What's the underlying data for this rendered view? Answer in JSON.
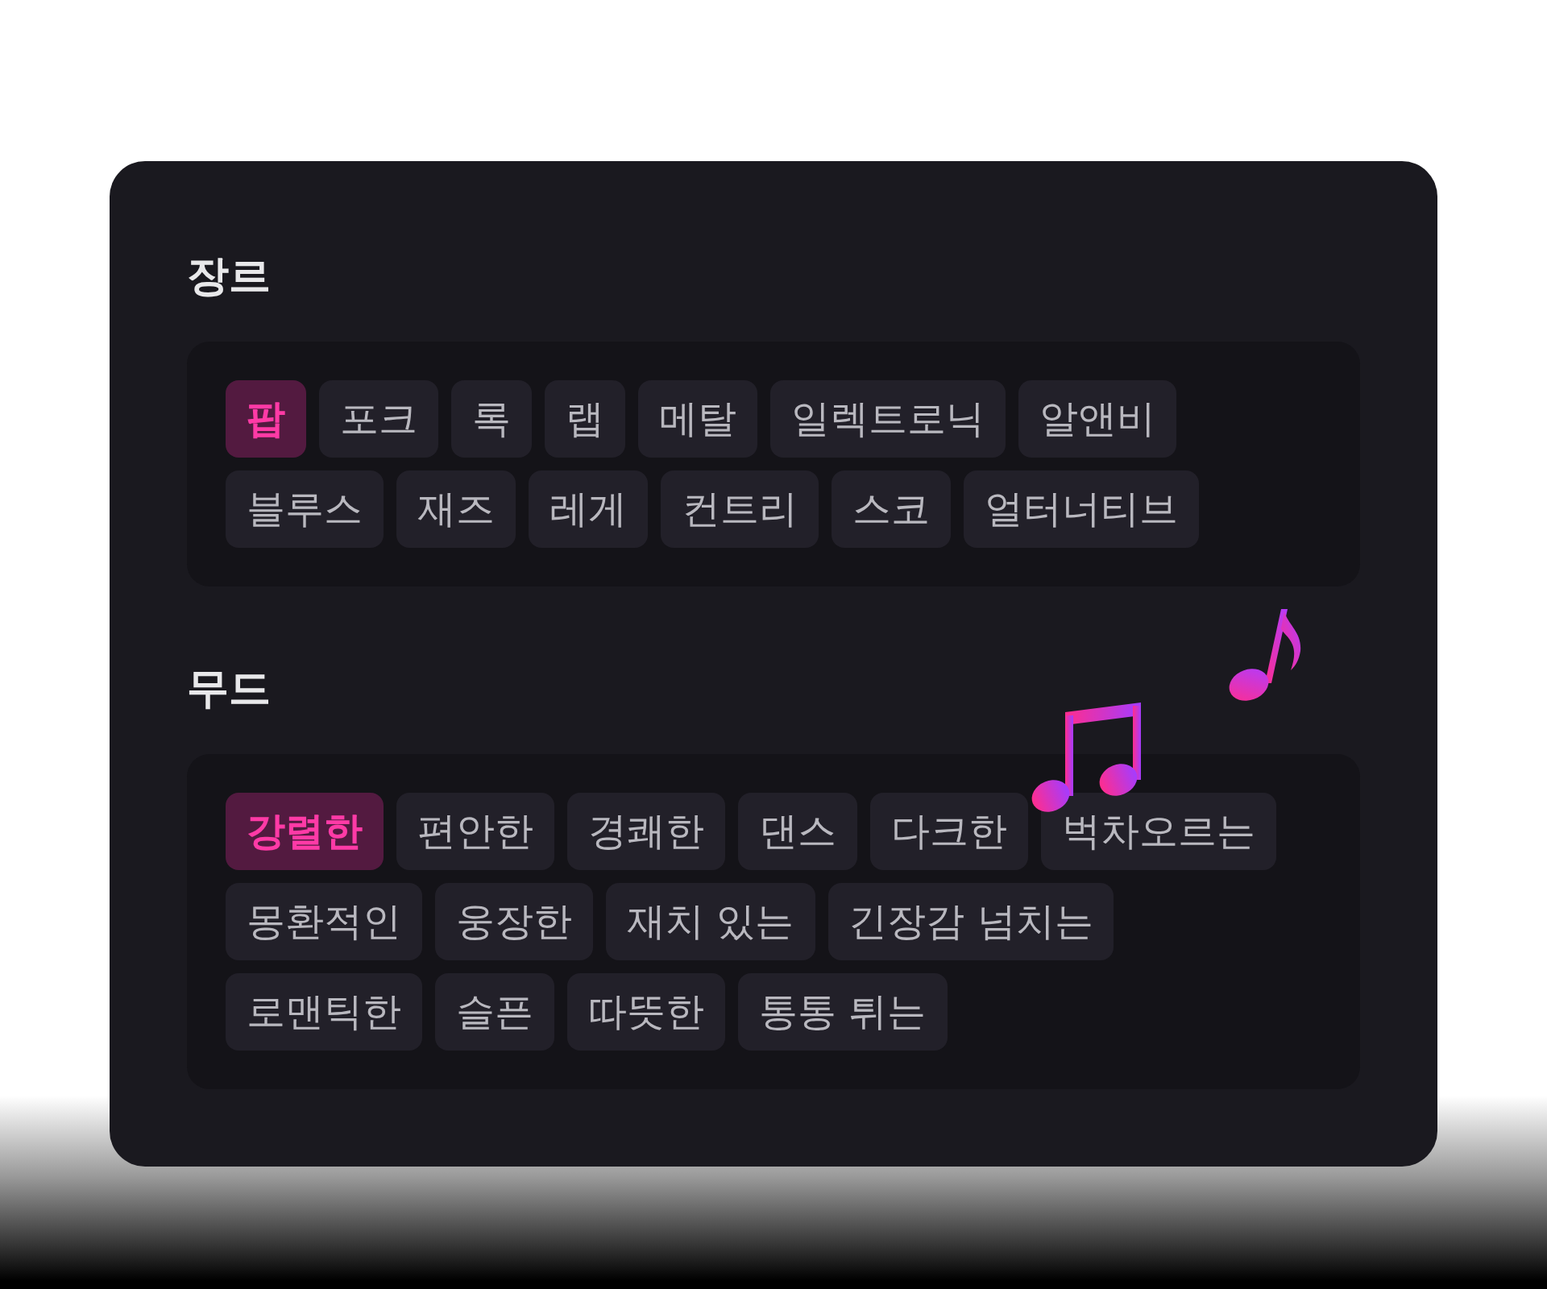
{
  "sections": [
    {
      "title": "장르",
      "tags": [
        {
          "label": "팝",
          "selected": true
        },
        {
          "label": "포크",
          "selected": false
        },
        {
          "label": "록",
          "selected": false
        },
        {
          "label": "랩",
          "selected": false
        },
        {
          "label": "메탈",
          "selected": false
        },
        {
          "label": "일렉트로닉",
          "selected": false
        },
        {
          "label": "알앤비",
          "selected": false
        },
        {
          "label": "블루스",
          "selected": false
        },
        {
          "label": "재즈",
          "selected": false
        },
        {
          "label": "레게",
          "selected": false
        },
        {
          "label": "컨트리",
          "selected": false
        },
        {
          "label": "스코",
          "selected": false
        },
        {
          "label": "얼터너티브",
          "selected": false
        }
      ]
    },
    {
      "title": "무드",
      "tags": [
        {
          "label": "강렬한",
          "selected": true
        },
        {
          "label": "편안한",
          "selected": false
        },
        {
          "label": "경쾌한",
          "selected": false
        },
        {
          "label": "댄스",
          "selected": false
        },
        {
          "label": "다크한",
          "selected": false
        },
        {
          "label": "벅차오르는",
          "selected": false
        },
        {
          "label": "몽환적인",
          "selected": false
        },
        {
          "label": "웅장한",
          "selected": false
        },
        {
          "label": "재치 있는",
          "selected": false
        },
        {
          "label": "긴장감 넘치는",
          "selected": false
        },
        {
          "label": "로맨틱한",
          "selected": false
        },
        {
          "label": "슬픈",
          "selected": false
        },
        {
          "label": "따뜻한",
          "selected": false
        },
        {
          "label": "통통 튀는",
          "selected": false
        }
      ]
    }
  ]
}
